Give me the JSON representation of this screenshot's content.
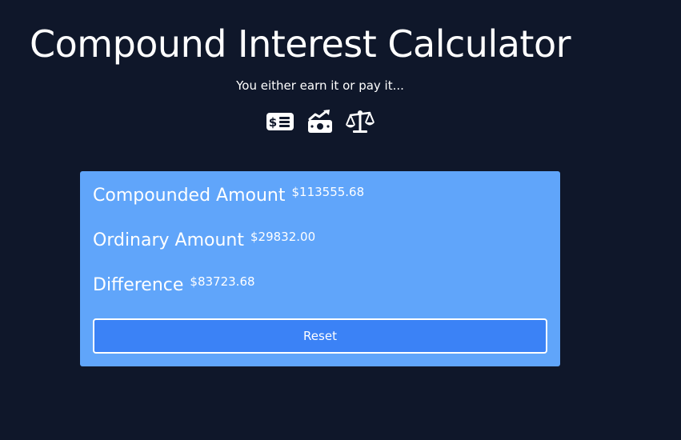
{
  "header": {
    "title": "Compound Interest Calculator",
    "subtitle": "You either earn it or pay it..."
  },
  "icons": [
    "money-check-dollar-icon",
    "money-bill-trend-up-icon",
    "scale-balanced-icon"
  ],
  "results": {
    "compounded": {
      "label": "Compounded Amount",
      "value": "$113555.68"
    },
    "ordinary": {
      "label": "Ordinary Amount",
      "value": "$29832.00"
    },
    "difference": {
      "label": "Difference",
      "value": "$83723.68"
    }
  },
  "actions": {
    "reset_label": "Reset"
  },
  "colors": {
    "background": "#0f172a",
    "card": "#60a5fa",
    "button": "#3b82f6",
    "text": "#ffffff"
  }
}
